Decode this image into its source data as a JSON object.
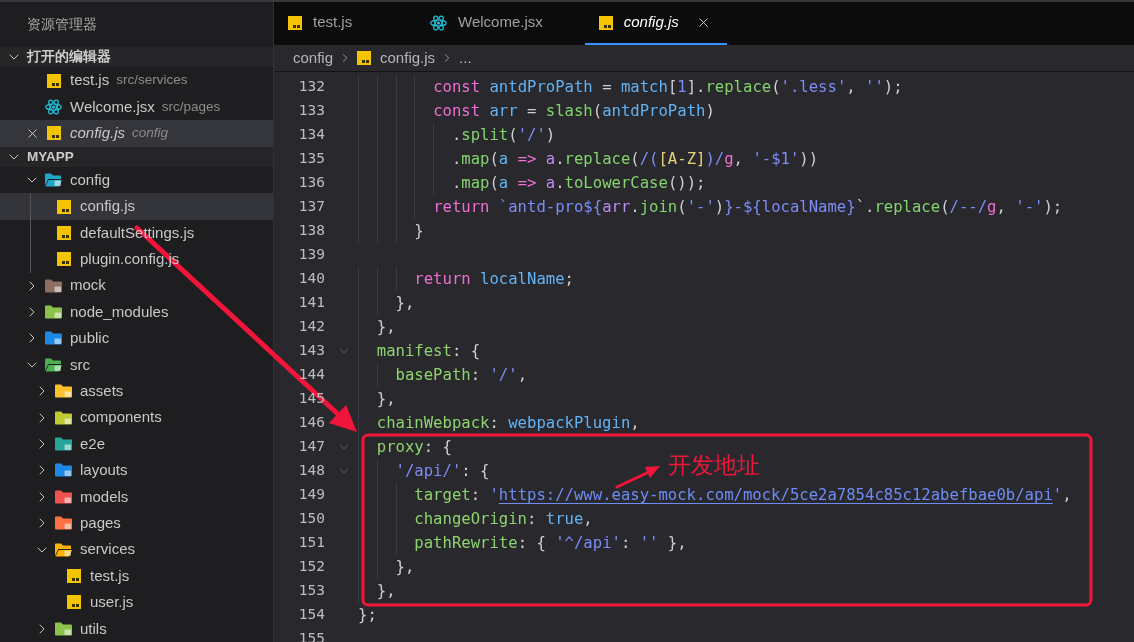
{
  "sidebar": {
    "title": "资源管理器",
    "open_editors": {
      "title": "打开的编辑器",
      "expanded": true,
      "items": [
        {
          "name": "test.js",
          "path": "src/services",
          "kind": "js",
          "selected": false,
          "preview": false
        },
        {
          "name": "Welcome.jsx",
          "path": "src/pages",
          "kind": "jsx",
          "selected": false,
          "preview": false
        },
        {
          "name": "config.js",
          "path": "config",
          "kind": "js",
          "selected": true,
          "preview": true
        }
      ]
    },
    "workspace": {
      "title": "MYAPP",
      "expanded": true,
      "tree": [
        {
          "name": "config",
          "kind": "folder",
          "color": "#22a7c9",
          "expanded": true,
          "selected": false,
          "children": [
            {
              "name": "config.js",
              "kind": "js",
              "selected": true
            },
            {
              "name": "defaultSettings.js",
              "kind": "js",
              "selected": false
            },
            {
              "name": "plugin.config.js",
              "kind": "js",
              "selected": false
            }
          ]
        },
        {
          "name": "mock",
          "kind": "folder",
          "color": "#8d6e63",
          "expanded": false,
          "selected": false
        },
        {
          "name": "node_modules",
          "kind": "folder",
          "color": "#8bc34a",
          "expanded": false,
          "selected": false
        },
        {
          "name": "public",
          "kind": "folder",
          "color": "#1e88e5",
          "expanded": false,
          "selected": false
        },
        {
          "name": "src",
          "kind": "folder",
          "color": "#4caf50",
          "expanded": true,
          "selected": false,
          "children": [
            {
              "name": "assets",
              "kind": "folder",
              "color": "#fbc02d",
              "expanded": false,
              "selected": false
            },
            {
              "name": "components",
              "kind": "folder",
              "color": "#c0ca33",
              "expanded": false,
              "selected": false
            },
            {
              "name": "e2e",
              "kind": "folder",
              "color": "#26a69a",
              "expanded": false,
              "selected": false
            },
            {
              "name": "layouts",
              "kind": "folder",
              "color": "#1e88e5",
              "expanded": false,
              "selected": false
            },
            {
              "name": "models",
              "kind": "folder",
              "color": "#ef5350",
              "expanded": false,
              "selected": false
            },
            {
              "name": "pages",
              "kind": "folder",
              "color": "#ff7043",
              "expanded": false,
              "selected": false
            },
            {
              "name": "services",
              "kind": "folder",
              "color": "#ffb300",
              "expanded": true,
              "selected": false,
              "children": [
                {
                  "name": "test.js",
                  "kind": "js",
                  "selected": false
                },
                {
                  "name": "user.js",
                  "kind": "js",
                  "selected": false
                }
              ]
            },
            {
              "name": "utils",
              "kind": "folder",
              "color": "#8bc34a",
              "expanded": false,
              "selected": false
            }
          ]
        }
      ]
    }
  },
  "tabs": [
    {
      "name": "test.js",
      "kind": "js",
      "selected": false,
      "preview": false
    },
    {
      "name": "Welcome.jsx",
      "kind": "jsx",
      "selected": false,
      "preview": false
    },
    {
      "name": "config.js",
      "kind": "js",
      "selected": true,
      "preview": true
    }
  ],
  "breadcrumbs": [
    {
      "label": "config",
      "kind": "folder"
    },
    {
      "label": "config.js",
      "kind": "js"
    },
    {
      "label": "...",
      "kind": "symbol"
    }
  ],
  "editor": {
    "lines": [
      {
        "number": "132",
        "fold": false,
        "tokens": [
          {
            "text": "        const ",
            "kind": "keyword"
          },
          {
            "text": "antdProPath",
            "kind": "variable"
          },
          {
            "text": " = ",
            "kind": "punct"
          },
          {
            "text": "match",
            "kind": "variable"
          },
          {
            "text": "[",
            "kind": "punct"
          },
          {
            "text": "1",
            "kind": "number"
          },
          {
            "text": "].",
            "kind": "punct"
          },
          {
            "text": "replace",
            "kind": "function"
          },
          {
            "text": "(",
            "kind": "punct"
          },
          {
            "text": "'.less'",
            "kind": "string"
          },
          {
            "text": ", ",
            "kind": "punct"
          },
          {
            "text": "''",
            "kind": "string"
          },
          {
            "text": ");",
            "kind": "punct"
          }
        ]
      },
      {
        "number": "133",
        "fold": false,
        "tokens": [
          {
            "text": "        const ",
            "kind": "keyword"
          },
          {
            "text": "arr",
            "kind": "variable"
          },
          {
            "text": " = ",
            "kind": "punct"
          },
          {
            "text": "slash",
            "kind": "function"
          },
          {
            "text": "(",
            "kind": "punct"
          },
          {
            "text": "antdProPath",
            "kind": "variable"
          },
          {
            "text": ")",
            "kind": "punct"
          }
        ]
      },
      {
        "number": "134",
        "fold": false,
        "tokens": [
          {
            "text": "          .",
            "kind": "punct"
          },
          {
            "text": "split",
            "kind": "function"
          },
          {
            "text": "(",
            "kind": "punct"
          },
          {
            "text": "'/'",
            "kind": "string"
          },
          {
            "text": ")",
            "kind": "punct"
          }
        ]
      },
      {
        "number": "135",
        "fold": false,
        "tokens": [
          {
            "text": "          .",
            "kind": "punct"
          },
          {
            "text": "map",
            "kind": "function"
          },
          {
            "text": "(",
            "kind": "punct"
          },
          {
            "text": "a",
            "kind": "variable"
          },
          {
            "text": " => ",
            "kind": "keyword"
          },
          {
            "text": "a",
            "kind": "param"
          },
          {
            "text": ".",
            "kind": "punct"
          },
          {
            "text": "replace",
            "kind": "function"
          },
          {
            "text": "(",
            "kind": "punct"
          },
          {
            "text": "/(",
            "kind": "string"
          },
          {
            "text": "[A-Z]",
            "kind": "regex"
          },
          {
            "text": ")/",
            "kind": "string"
          },
          {
            "text": "g",
            "kind": "keyword"
          },
          {
            "text": ", ",
            "kind": "punct"
          },
          {
            "text": "'-$1'",
            "kind": "string"
          },
          {
            "text": "))",
            "kind": "punct"
          }
        ]
      },
      {
        "number": "136",
        "fold": false,
        "tokens": [
          {
            "text": "          .",
            "kind": "punct"
          },
          {
            "text": "map",
            "kind": "function"
          },
          {
            "text": "(",
            "kind": "punct"
          },
          {
            "text": "a",
            "kind": "variable"
          },
          {
            "text": " => ",
            "kind": "keyword"
          },
          {
            "text": "a",
            "kind": "param"
          },
          {
            "text": ".",
            "kind": "punct"
          },
          {
            "text": "toLowerCase",
            "kind": "function"
          },
          {
            "text": "());",
            "kind": "punct"
          }
        ]
      },
      {
        "number": "137",
        "fold": false,
        "tokens": [
          {
            "text": "        return ",
            "kind": "keyword"
          },
          {
            "text": "`antd-pro${",
            "kind": "string"
          },
          {
            "text": "arr",
            "kind": "param"
          },
          {
            "text": ".",
            "kind": "punct"
          },
          {
            "text": "join",
            "kind": "function"
          },
          {
            "text": "(",
            "kind": "punct"
          },
          {
            "text": "'-'",
            "kind": "string"
          },
          {
            "text": ")",
            "kind": "punct"
          },
          {
            "text": "}-${localName}",
            "kind": "string"
          },
          {
            "text": "`.",
            "kind": "punct"
          },
          {
            "text": "replace",
            "kind": "function"
          },
          {
            "text": "(",
            "kind": "punct"
          },
          {
            "text": "/--/",
            "kind": "string"
          },
          {
            "text": "g",
            "kind": "keyword"
          },
          {
            "text": ", ",
            "kind": "punct"
          },
          {
            "text": "'-'",
            "kind": "string"
          },
          {
            "text": ");",
            "kind": "punct"
          }
        ]
      },
      {
        "number": "138",
        "fold": false,
        "tokens": [
          {
            "text": "      }",
            "kind": "punct"
          }
        ]
      },
      {
        "number": "139",
        "fold": false
      },
      {
        "number": "140",
        "fold": false,
        "tokens": [
          {
            "text": "      return ",
            "kind": "keyword"
          },
          {
            "text": "localName",
            "kind": "variable"
          },
          {
            "text": ";",
            "kind": "punct"
          }
        ]
      },
      {
        "number": "141",
        "fold": false,
        "tokens": [
          {
            "text": "    },",
            "kind": "punct"
          }
        ]
      },
      {
        "number": "142",
        "fold": false,
        "tokens": [
          {
            "text": "  },",
            "kind": "punct"
          }
        ]
      },
      {
        "number": "143",
        "fold": true,
        "tokens": [
          {
            "text": "  manifest",
            "kind": "property"
          },
          {
            "text": ": {",
            "kind": "punct"
          }
        ]
      },
      {
        "number": "144",
        "fold": false,
        "tokens": [
          {
            "text": "    basePath",
            "kind": "property"
          },
          {
            "text": ": ",
            "kind": "punct"
          },
          {
            "text": "'/'",
            "kind": "string"
          },
          {
            "text": ",",
            "kind": "punct"
          }
        ]
      },
      {
        "number": "145",
        "fold": false,
        "tokens": [
          {
            "text": "  },",
            "kind": "punct"
          }
        ]
      },
      {
        "number": "146",
        "fold": false,
        "tokens": [
          {
            "text": "  chainWebpack",
            "kind": "property"
          },
          {
            "text": ": ",
            "kind": "punct"
          },
          {
            "text": "webpackPlugin",
            "kind": "variable"
          },
          {
            "text": ",",
            "kind": "punct"
          }
        ]
      },
      {
        "number": "147",
        "fold": true,
        "tokens": [
          {
            "text": "  proxy",
            "kind": "property"
          },
          {
            "text": ": {",
            "kind": "punct"
          }
        ]
      },
      {
        "number": "148",
        "fold": true,
        "tokens": [
          {
            "text": "    '/api/'",
            "kind": "string"
          },
          {
            "text": ": {",
            "kind": "punct"
          }
        ]
      },
      {
        "number": "149",
        "fold": false,
        "tokens": [
          {
            "text": "      target",
            "kind": "property"
          },
          {
            "text": ": ",
            "kind": "punct"
          },
          {
            "text": "'",
            "kind": "string"
          },
          {
            "text": "https://www.easy-mock.com/mock/5ce2a7854c85c12abefbae0b/api",
            "kind": "link"
          },
          {
            "text": "'",
            "kind": "string"
          },
          {
            "text": ",",
            "kind": "punct"
          }
        ]
      },
      {
        "number": "150",
        "fold": false,
        "tokens": [
          {
            "text": "      changeOrigin",
            "kind": "property"
          },
          {
            "text": ": ",
            "kind": "punct"
          },
          {
            "text": "true",
            "kind": "variable"
          },
          {
            "text": ",",
            "kind": "punct"
          }
        ]
      },
      {
        "number": "151",
        "fold": false,
        "tokens": [
          {
            "text": "      pathRewrite",
            "kind": "property"
          },
          {
            "text": ": { ",
            "kind": "punct"
          },
          {
            "text": "'^/api'",
            "kind": "string"
          },
          {
            "text": ": ",
            "kind": "punct"
          },
          {
            "text": "''",
            "kind": "string"
          },
          {
            "text": " },",
            "kind": "punct"
          }
        ]
      },
      {
        "number": "152",
        "fold": false,
        "tokens": [
          {
            "text": "    },",
            "kind": "punct"
          }
        ]
      },
      {
        "number": "153",
        "fold": false,
        "tokens": [
          {
            "text": "  },",
            "kind": "punct"
          }
        ]
      },
      {
        "number": "154",
        "fold": false,
        "tokens": [
          {
            "text": "};",
            "kind": "punct"
          }
        ]
      },
      {
        "number": "155",
        "fold": false
      }
    ]
  },
  "annotation": {
    "label": "开发地址"
  }
}
